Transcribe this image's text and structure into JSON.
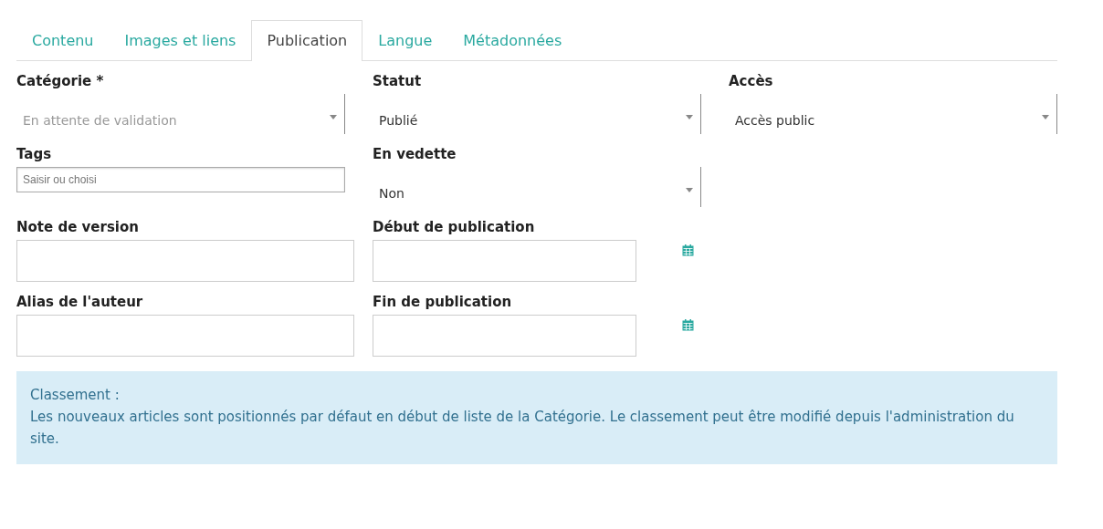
{
  "tabs": [
    {
      "label": "Contenu",
      "selected": false
    },
    {
      "label": "Images et liens",
      "selected": false
    },
    {
      "label": "Publication",
      "selected": true
    },
    {
      "label": "Langue",
      "selected": false
    },
    {
      "label": "Métadonnées",
      "selected": false
    }
  ],
  "rows": [
    [
      {
        "label": "Catégorie *",
        "kind": "select",
        "value": "En attente de validation",
        "disabled": true
      },
      {
        "label": "Statut",
        "kind": "select",
        "value": "Publié",
        "disabled": false
      },
      {
        "label": "Accès",
        "kind": "select",
        "value": "Accès public",
        "disabled": false
      }
    ],
    [
      {
        "label": "Tags",
        "kind": "tags",
        "placeholder": "Saisir ou choisi"
      },
      {
        "label": "En vedette",
        "kind": "select",
        "value": "Non",
        "disabled": false
      }
    ],
    [
      {
        "label": "Note de version",
        "kind": "text"
      },
      {
        "label": "Début de publication",
        "kind": "date"
      }
    ],
    [
      {
        "label": "Alias de l'auteur",
        "kind": "text"
      },
      {
        "label": "Fin de publication",
        "kind": "date"
      }
    ]
  ],
  "notice": {
    "title": "Classement :",
    "text": "Les nouveaux articles sont positionnés par défaut en début de liste de la Catégorie. Le classement peut être modifié depuis l'administration du site."
  }
}
